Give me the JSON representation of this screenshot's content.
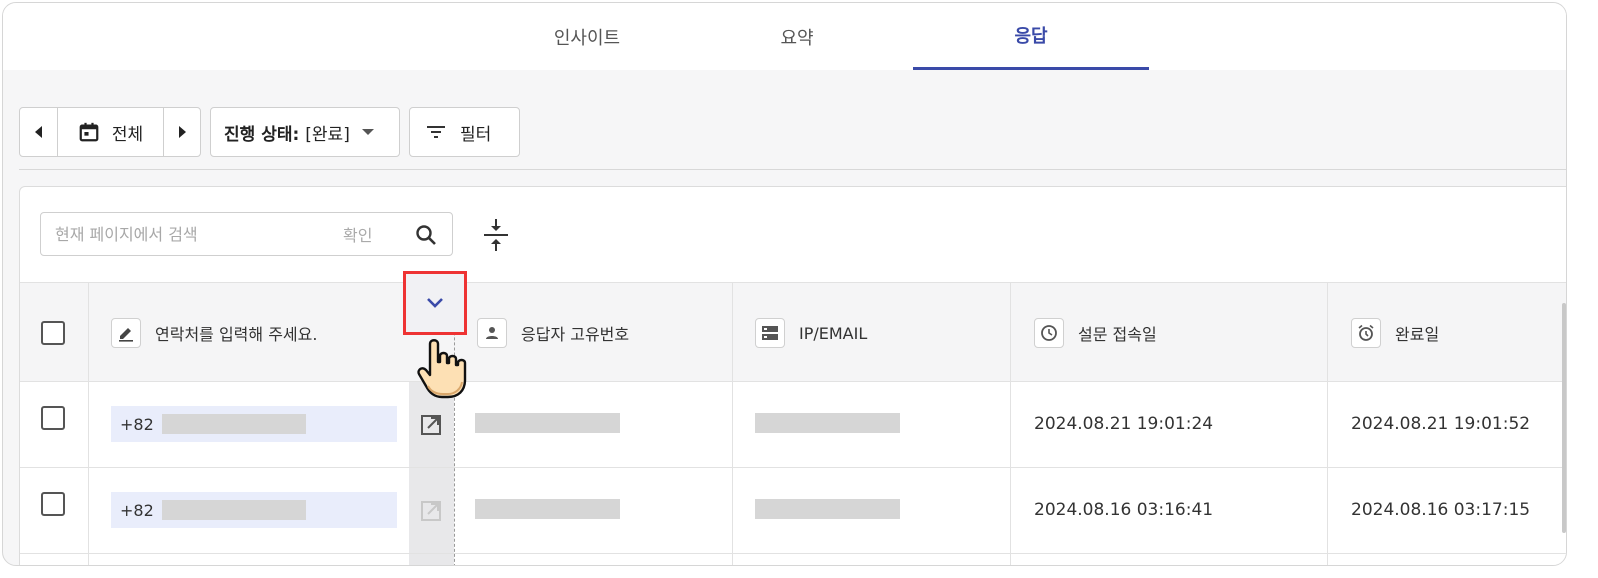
{
  "tabs": [
    {
      "label": "인사이트",
      "active": false
    },
    {
      "label": "요약",
      "active": false
    },
    {
      "label": "응답",
      "active": true
    }
  ],
  "toolbar": {
    "period_label": "전체",
    "status_prefix": "진행 상태:",
    "status_value": "[완료]",
    "filter_label": "필터"
  },
  "search": {
    "placeholder": "현재 페이지에서 검색",
    "confirm_label": "확인"
  },
  "columns": [
    {
      "label": "연락처를 입력해 주세요.",
      "icon": "pencil-icon"
    },
    {
      "label": "응답자 고유번호",
      "icon": "person-icon"
    },
    {
      "label": "IP/EMAIL",
      "icon": "server-icon"
    },
    {
      "label": "설문 접속일",
      "icon": "clock-icon"
    },
    {
      "label": "완료일",
      "icon": "alarm-icon"
    }
  ],
  "rows": [
    {
      "phone_prefix": "+82",
      "accessed": "2024.08.21 19:01:24",
      "completed": "2024.08.21 19:01:52",
      "open_enabled": true
    },
    {
      "phone_prefix": "+82",
      "accessed": "2024.08.16 03:16:41",
      "completed": "2024.08.16 03:17:15",
      "open_enabled": false
    }
  ],
  "colors": {
    "accent": "#3a4aa8",
    "highlight_box": "#ee3333",
    "phone_bg": "#e9edfb"
  }
}
